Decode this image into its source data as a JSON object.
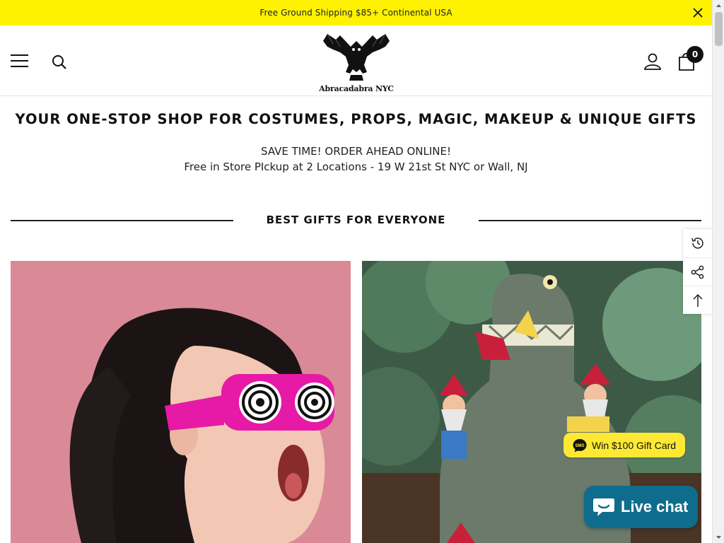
{
  "announcement": {
    "text": "Free Ground Shipping $85+ Continental USA",
    "close_icon": "close-icon"
  },
  "header": {
    "menu_icon": "hamburger-menu-icon",
    "search_icon": "search-icon",
    "logo_text": "Abracadabra NYC",
    "account_icon": "user-icon",
    "cart_icon": "shopping-bag-icon",
    "cart_count": "0"
  },
  "hero": {
    "tagline": "YOUR ONE-STOP SHOP FOR COSTUMES, PROPS, MAGIC, MAKEUP & UNIQUE GIFTS",
    "line1": "SAVE TIME! ORDER AHEAD ONLINE!",
    "line2": "Free in Store PIckup at 2 Locations - 19 W 21st St NYC or Wall, NJ"
  },
  "section": {
    "title": "BEST GIFTS FOR EVERYONE"
  },
  "products": [
    {
      "image": "woman-with-pink-hypno-glasses-photo"
    },
    {
      "image": "dinosaur-eating-garden-gnomes-photo"
    }
  ],
  "side_tools": [
    {
      "icon": "recently-viewed-icon"
    },
    {
      "icon": "share-icon"
    },
    {
      "icon": "arrow-up-icon"
    }
  ],
  "sms_widget": {
    "label": "Win $100 Gift Card",
    "icon": "sms-chat-icon"
  },
  "live_chat": {
    "label": "Live chat",
    "icon": "chat-bubble-icon"
  },
  "colors": {
    "announcement_bg": "#fff200",
    "sms_bg": "#fde933",
    "live_chat_bg": "#0e6d8c",
    "text": "#111111"
  }
}
